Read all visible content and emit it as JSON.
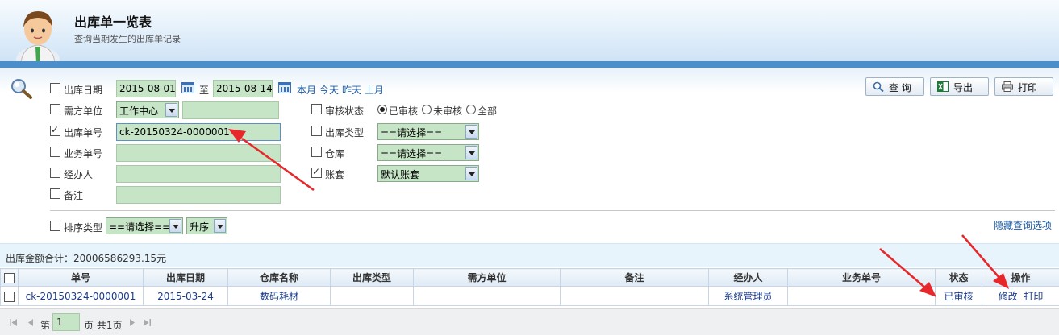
{
  "header": {
    "title": "出库单一览表",
    "subtitle": "查询当期发生的出库单记录"
  },
  "search": {
    "date_label": "出库日期",
    "date_from": "2015-08-01",
    "to_label": "至",
    "date_to": "2015-08-14",
    "quick_links": [
      "本月",
      "今天",
      "昨天",
      "上月"
    ],
    "dept_label": "需方单位",
    "dept_select": "工作中心",
    "dept_text": "",
    "order_no_label": "出库单号",
    "order_no_value": "ck-20150324-0000001",
    "biz_no_label": "业务单号",
    "biz_no_value": "",
    "handler_label": "经办人",
    "handler_value": "",
    "remark_label": "备注",
    "remark_value": "",
    "audit_label": "审核状态",
    "audit_options": [
      "已审核",
      "未审核",
      "全部"
    ],
    "audit_selected": "已审核",
    "out_type_label": "出库类型",
    "out_type_select": "==请选择==",
    "warehouse_label": "仓库",
    "warehouse_select": "==请选择==",
    "account_label": "账套",
    "account_select": "默认账套",
    "sort_label": "排序类型",
    "sort_select": "==请选择==",
    "sort_order_select": "升序",
    "hide_link": "隐藏查询选项",
    "checked": {
      "date": false,
      "dept": false,
      "order_no": true,
      "biz_no": false,
      "handler": false,
      "remark": false,
      "audit": false,
      "out_type": false,
      "warehouse": false,
      "account": true,
      "sort": false
    }
  },
  "toolbar": {
    "query_label": "查 询",
    "export_label": "导出",
    "print_label": "打印"
  },
  "summary": {
    "text": "出库金额合计：20006586293.15元"
  },
  "table": {
    "columns": [
      "单号",
      "出库日期",
      "仓库名称",
      "出库类型",
      "需方单位",
      "备注",
      "经办人",
      "业务单号",
      "状态",
      "操作"
    ],
    "rows": [
      {
        "order_no": "ck-20150324-0000001",
        "date": "2015-03-24",
        "warehouse": "数码耗材",
        "out_type": "",
        "dept": "",
        "remark": "",
        "handler": "系统管理员",
        "biz_no": "",
        "status": "已审核",
        "action_edit": "修改",
        "action_print": "打印"
      }
    ]
  },
  "pager": {
    "page_prefix": "第",
    "page_value": "1",
    "page_suffix": "页 共1页"
  },
  "colors": {
    "header_bar": "#4a8fc9",
    "field_bg": "#c6e5c6",
    "link": "#1a5ba6",
    "annotation_arrow": "#e8272a"
  }
}
